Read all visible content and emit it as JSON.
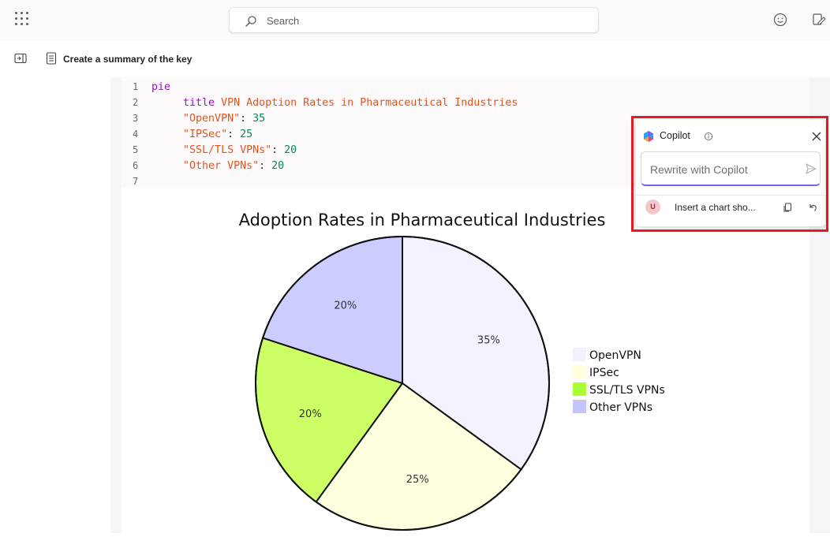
{
  "topbar": {
    "search_placeholder": "Search"
  },
  "subbar": {
    "doc_title": "Create a summary of the key"
  },
  "editor": {
    "lines": [
      {
        "n": "1",
        "keyword": "pie"
      },
      {
        "n": "2",
        "keyword": "title",
        "text": "VPN Adoption Rates in Pharmaceutical Industries"
      },
      {
        "n": "3",
        "key": "\"OpenVPN\"",
        "value": "35"
      },
      {
        "n": "4",
        "key": "\"IPSec\"",
        "value": "25"
      },
      {
        "n": "5",
        "key": "\"SSL/TLS VPNs\"",
        "value": "20"
      },
      {
        "n": "6",
        "key": "\"Other VPNs\"",
        "value": "20"
      },
      {
        "n": "7"
      }
    ]
  },
  "chart_data": {
    "type": "pie",
    "title": "Adoption Rates in Pharmaceutical Industries",
    "categories": [
      "OpenVPN",
      "IPSec",
      "SSL/TLS VPNs",
      "Other VPNs"
    ],
    "values": [
      35,
      25,
      20,
      20
    ],
    "labels": [
      "35%",
      "25%",
      "20%",
      "20%"
    ],
    "colors": [
      "#f4f2ff",
      "#ffffe0",
      "#ccff66",
      "#ccccff"
    ],
    "legend_swatch_colors": [
      "#f0f0ff",
      "#ffffdd",
      "#aaff33",
      "#c4c4ff"
    ],
    "legend": "right"
  },
  "copilot": {
    "title": "Copilot",
    "input_placeholder": "Rewrite with Copilot",
    "history": [
      {
        "avatar": "U",
        "text": "Insert a chart sho..."
      }
    ]
  },
  "colors": {
    "accent": "#7b5cf0",
    "highlight": "#e01b24"
  }
}
